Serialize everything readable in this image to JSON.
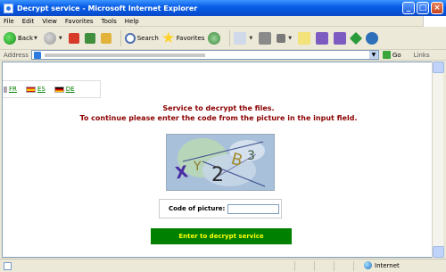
{
  "window": {
    "title": "Decrypt service - Microsoft Internet Explorer",
    "controls": [
      "_",
      "□",
      "×"
    ]
  },
  "menu": [
    "File",
    "Edit",
    "View",
    "Favorites",
    "Tools",
    "Help"
  ],
  "toolbar": {
    "back_label": "Back",
    "search_label": "Search",
    "favorites_label": "Favorites"
  },
  "address": {
    "label": "Address",
    "go_label": "Go",
    "links_label": "Links"
  },
  "languages": [
    {
      "code": "FR",
      "label": "FR"
    },
    {
      "code": "ES",
      "label": "ES"
    },
    {
      "code": "DE",
      "label": "DE"
    }
  ],
  "page": {
    "heading_line1": "Service to decrypt the files.",
    "heading_line2": "To continue please enter the code from the picture in the input field.",
    "captcha_text": "X Y 2 B 3",
    "code_label": "Code of picture:",
    "code_value": "",
    "submit_label": "Enter to decrypt service"
  },
  "status": {
    "zone_label": "Internet"
  },
  "colors": {
    "heading": "#8b0000",
    "button_bg": "#008000",
    "button_text": "#ffff00",
    "lang_link": "#008000"
  }
}
